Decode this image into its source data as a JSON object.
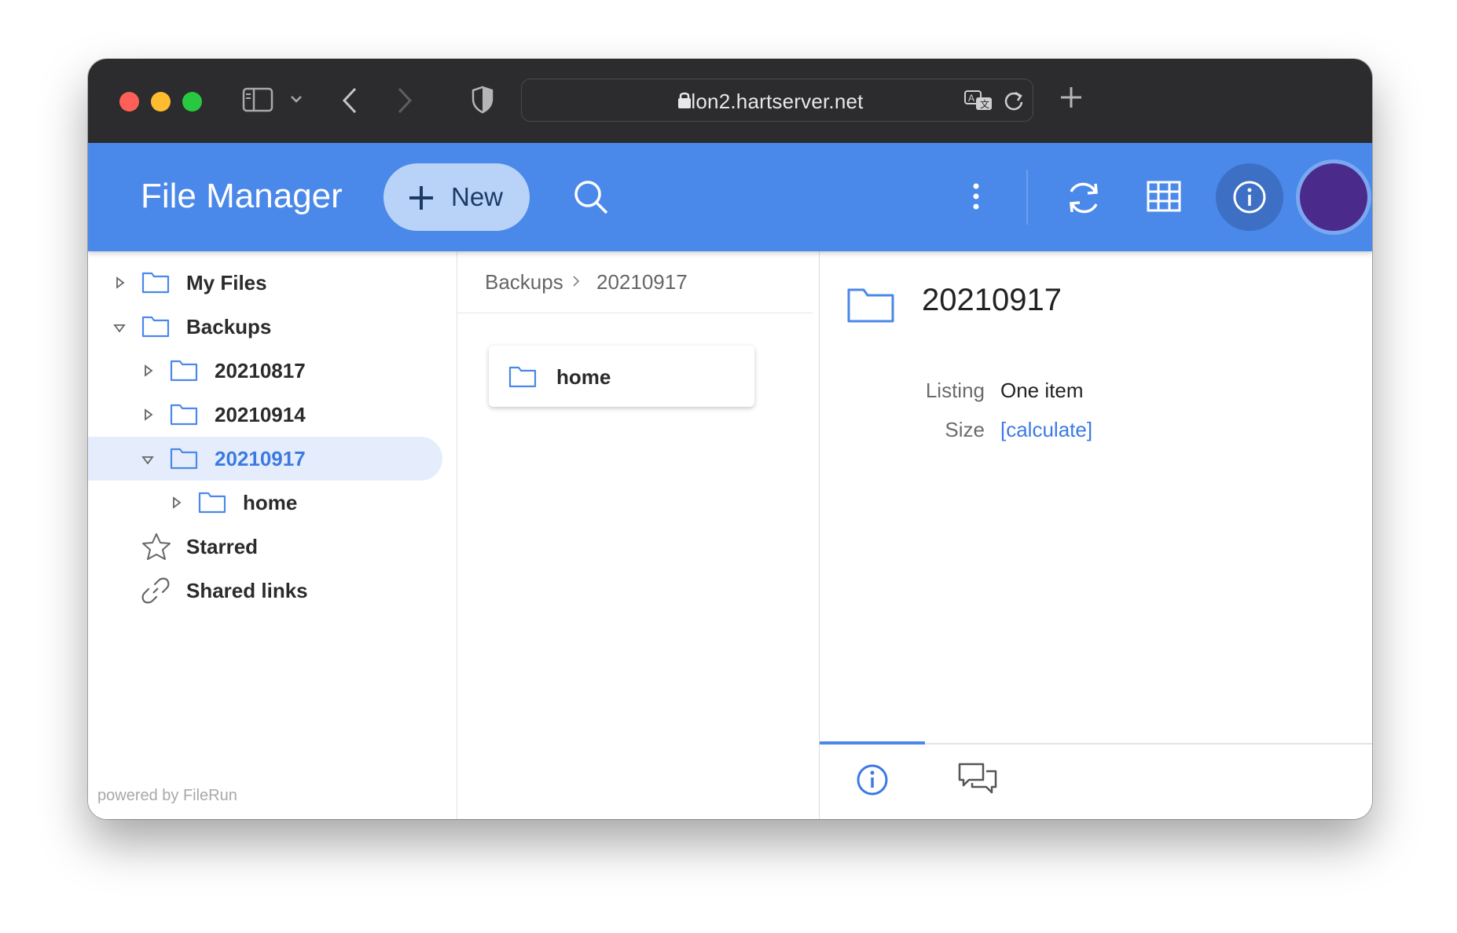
{
  "browser": {
    "url": "lon2.hartserver.net",
    "icons": [
      "sidebar-toggle-icon",
      "chevron-down-icon",
      "back-icon",
      "forward-icon",
      "privacy-shield-icon",
      "lock-icon",
      "translate-icon",
      "reload-icon",
      "new-tab-icon"
    ]
  },
  "header": {
    "title": "File Manager",
    "new_label": "New",
    "icons": [
      "plus-icon",
      "search-icon",
      "more-vert-icon",
      "refresh-icon",
      "grid-view-icon",
      "info-icon",
      "avatar"
    ]
  },
  "sidebar": {
    "items": [
      {
        "label": "My Files"
      },
      {
        "label": "Backups"
      },
      {
        "label": "20210817"
      },
      {
        "label": "20210914"
      },
      {
        "label": "20210917"
      },
      {
        "label": "home"
      },
      {
        "label": "Starred"
      },
      {
        "label": "Shared links"
      }
    ],
    "selected": "20210917",
    "footer": "powered by FileRun"
  },
  "breadcrumb": {
    "items": [
      "Backups",
      "20210917"
    ]
  },
  "files": [
    {
      "name": "home"
    }
  ],
  "details": {
    "title": "20210917",
    "listing_label": "Listing",
    "listing_value": "One item",
    "size_label": "Size",
    "size_value": "[calculate]",
    "tabs": [
      "info-icon",
      "comments-icon"
    ]
  },
  "colors": {
    "accent": "#4a88e9",
    "folder": "#4a88e9",
    "selected_bg": "#e5edfc",
    "link": "#3b7ae3"
  }
}
